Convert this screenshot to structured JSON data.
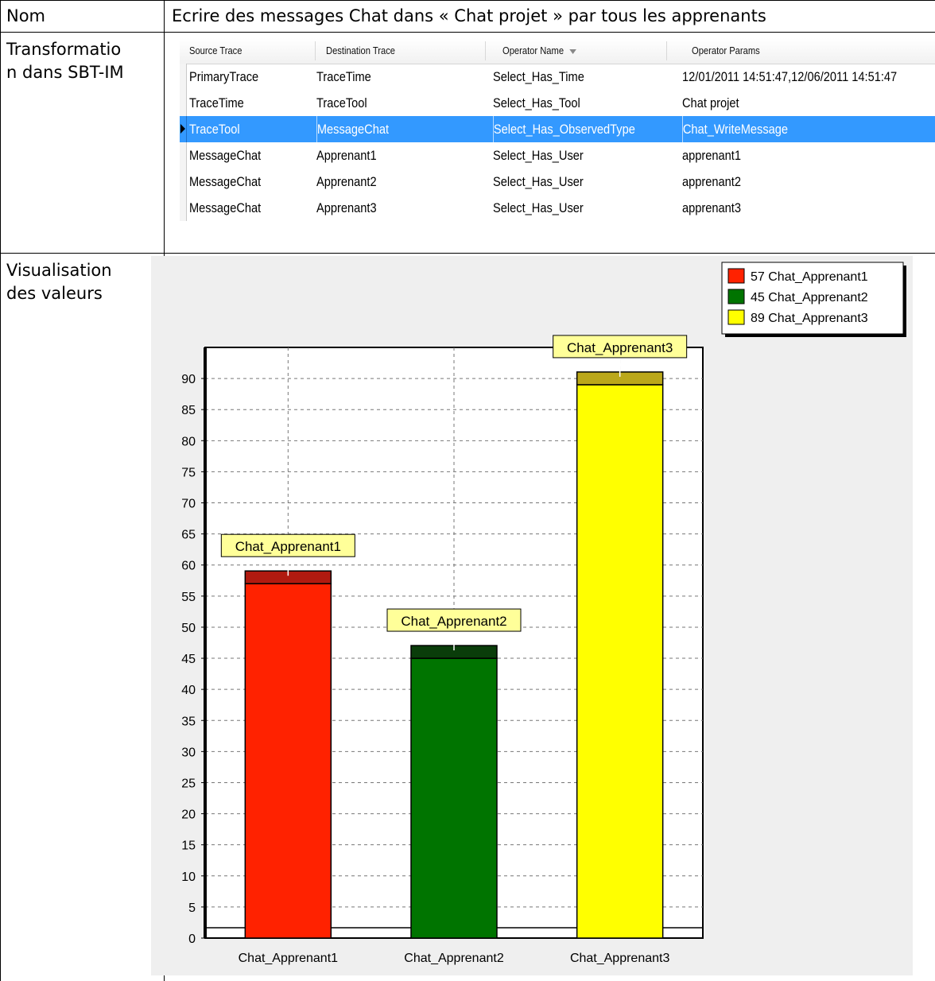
{
  "table": {
    "rows": [
      {
        "label": "Nom",
        "content": "Ecrire des messages Chat dans « Chat projet » par tous les apprenants"
      },
      {
        "label": "Transformatio\nn dans SBT-IM"
      },
      {
        "label": "Visualisation\ndes valeurs"
      }
    ]
  },
  "grid": {
    "columns": [
      "Source Trace",
      "Destination Trace",
      "Operator Name",
      "Operator Params"
    ],
    "sort_icon": "sort-down-icon",
    "selected_row": 2,
    "rows": [
      [
        "PrimaryTrace",
        "TraceTime",
        "Select_Has_Time",
        "12/01/2011 14:51:47,12/06/2011 14:51:47"
      ],
      [
        "TraceTime",
        "TraceTool",
        "Select_Has_Tool",
        "Chat projet"
      ],
      [
        "TraceTool",
        "MessageChat",
        "Select_Has_ObservedType",
        "Chat_WriteMessage"
      ],
      [
        "MessageChat",
        "Apprenant1",
        "Select_Has_User",
        "apprenant1"
      ],
      [
        "MessageChat",
        "Apprenant2",
        "Select_Has_User",
        "apprenant2"
      ],
      [
        "MessageChat",
        "Apprenant3",
        "Select_Has_User",
        "apprenant3"
      ]
    ]
  },
  "chart_data": {
    "type": "bar",
    "categories": [
      "Chat_Apprenant1",
      "Chat_Apprenant2",
      "Chat_Apprenant3"
    ],
    "values": [
      57,
      45,
      89
    ],
    "colors": [
      "#ff2200",
      "#007400",
      "#ffff00"
    ],
    "cap_colors": [
      "#b01a10",
      "#0a3d0a",
      "#bba81a"
    ],
    "bar_labels": [
      "Chat_Apprenant1",
      "Chat_Apprenant2",
      "Chat_Apprenant3"
    ],
    "legend": [
      "57 Chat_Apprenant1",
      "45 Chat_Apprenant2",
      "89 Chat_Apprenant3"
    ],
    "legend_position": "top-right",
    "yticks": [
      0,
      5,
      10,
      15,
      20,
      25,
      30,
      35,
      40,
      45,
      50,
      55,
      60,
      65,
      70,
      75,
      80,
      85,
      90
    ],
    "ylim": [
      0,
      95
    ],
    "grid": true
  }
}
